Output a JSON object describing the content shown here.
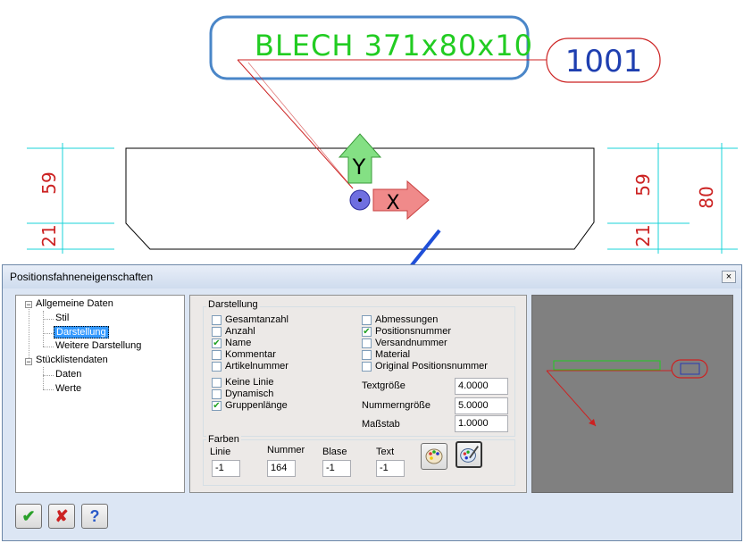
{
  "cad": {
    "position_text": "BLECH 371x80x10",
    "position_number": "1001",
    "axis_y": "Y",
    "axis_x": "X",
    "dim_left_top": "59",
    "dim_left_bottom": "21",
    "dim_right_top": "59",
    "dim_right_bottom": "21",
    "dim_right_total": "80",
    "colors": {
      "text": "#22cc22",
      "dim": "#cc2222",
      "leader": "#cc2222",
      "ext": "#19d3d8",
      "callout": "#4a86c8",
      "arrow": "#1f4fd8"
    }
  },
  "dialog": {
    "title": "Positionsfahneneigenschaften",
    "close_glyph": "×",
    "tree": {
      "root1": "Allgemeine Daten",
      "root1_children": [
        "Stil",
        "Darstellung",
        "Weitere Darstellung"
      ],
      "root2": "Stücklistendaten",
      "root2_children": [
        "Daten",
        "Werte"
      ]
    },
    "darstellung": {
      "group_label": "Darstellung",
      "left_checks": [
        {
          "label": "Gesamtanzahl",
          "checked": false
        },
        {
          "label": "Anzahl",
          "checked": false
        },
        {
          "label": "Name",
          "checked": true
        },
        {
          "label": "Kommentar",
          "checked": false
        },
        {
          "label": "Artikelnummer",
          "checked": false
        }
      ],
      "right_checks": [
        {
          "label": "Abmessungen",
          "checked": false
        },
        {
          "label": "Positionsnummer",
          "checked": true
        },
        {
          "label": "Versandnummer",
          "checked": false
        },
        {
          "label": "Material",
          "checked": false
        },
        {
          "label": "Original Positionsnummer",
          "checked": false
        }
      ],
      "line_checks": [
        {
          "label": "Keine Linie",
          "checked": false
        },
        {
          "label": "Dynamisch",
          "checked": false
        },
        {
          "label": "Gruppenlänge",
          "checked": true
        }
      ],
      "textgroesse_label": "Textgröße",
      "textgroesse_value": "4.0000",
      "nummerngroesse_label": "Nummerngröße",
      "nummerngroesse_value": "5.0000",
      "massstab_label": "Maßstab",
      "massstab_value": "1.0000"
    },
    "farben": {
      "group_label": "Farben",
      "linie_label": "Linie",
      "linie_value": "-1",
      "nummer_label": "Nummer",
      "nummer_value": "164",
      "blase_label": "Blase",
      "blase_value": "-1",
      "text_label": "Text",
      "text_value": "-1"
    },
    "buttons": {
      "ok": "✔",
      "cancel": "✘",
      "help": "?"
    }
  }
}
